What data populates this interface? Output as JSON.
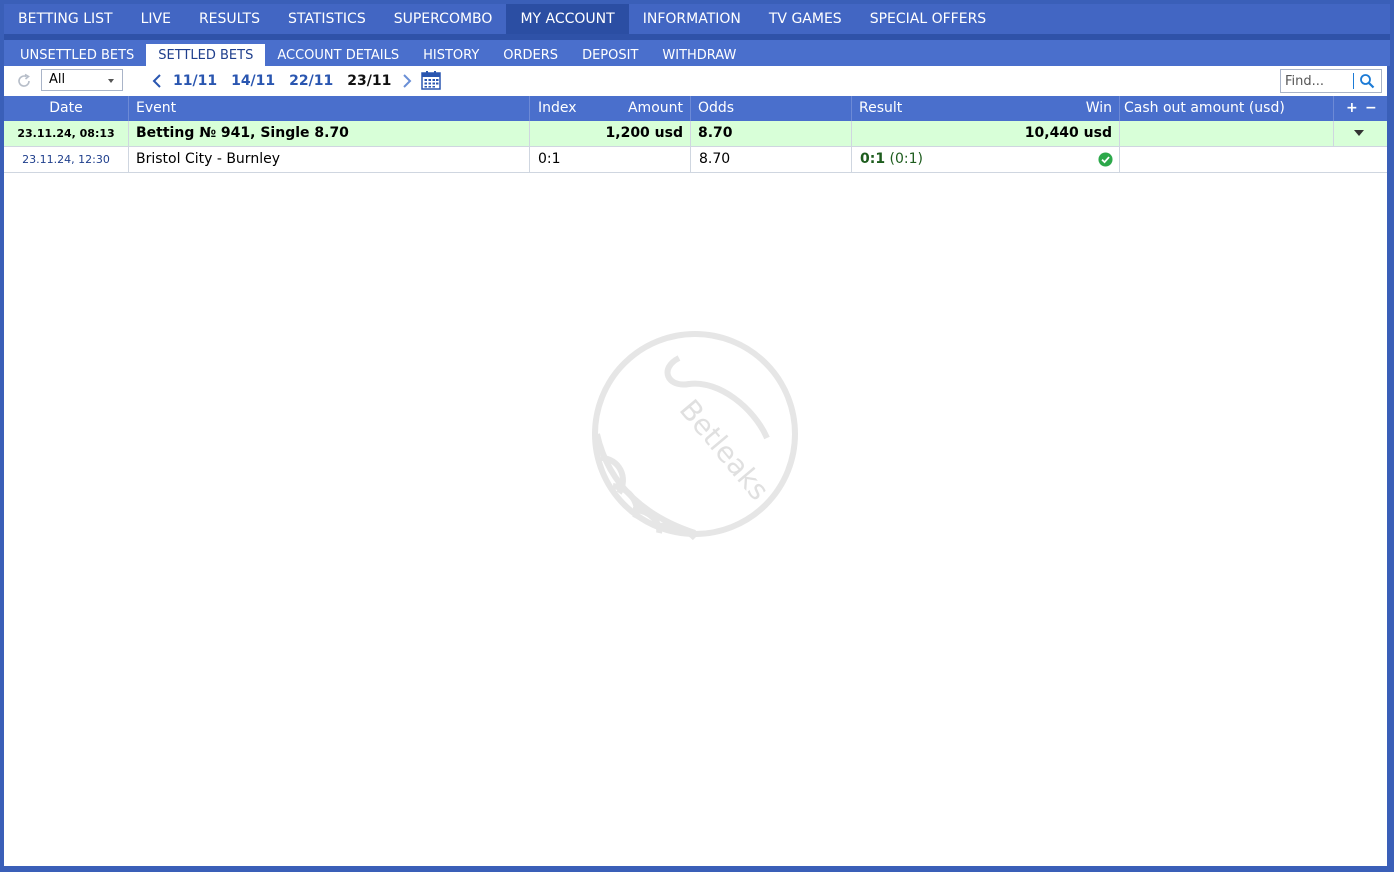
{
  "topnav": [
    {
      "label": "BETTING LIST"
    },
    {
      "label": "LIVE"
    },
    {
      "label": "RESULTS"
    },
    {
      "label": "STATISTICS"
    },
    {
      "label": "SUPERCOMBO"
    },
    {
      "label": "MY ACCOUNT"
    },
    {
      "label": "INFORMATION"
    },
    {
      "label": "TV GAMES"
    },
    {
      "label": "SPECIAL OFFERS"
    }
  ],
  "subnav": [
    {
      "label": "UNSETTLED BETS"
    },
    {
      "label": "SETTLED BETS"
    },
    {
      "label": "ACCOUNT DETAILS"
    },
    {
      "label": "HISTORY"
    },
    {
      "label": "ORDERS"
    },
    {
      "label": "DEPOSIT"
    },
    {
      "label": "WITHDRAW"
    }
  ],
  "toolbar": {
    "filter_value": "All",
    "dates": [
      "11/11",
      "14/11",
      "22/11",
      "23/11"
    ],
    "search_placeholder": "Find..."
  },
  "table": {
    "headers": {
      "date": "Date",
      "event": "Event",
      "index": "Index",
      "amount": "Amount",
      "odds": "Odds",
      "result": "Result",
      "win": "Win",
      "cashout": "Cash out amount (usd)",
      "expand": "+",
      "collapse": "−"
    },
    "bet": {
      "date": "23.11.24,  08:13",
      "title": "Betting № 941, Single 8.70",
      "amount": "1,200 usd",
      "odds": "8.70",
      "win": "10,440 usd"
    },
    "events": [
      {
        "date": "23.11.24, 12:30",
        "event": "Bristol City - Burnley",
        "index": "0:1",
        "odds": "8.70",
        "result_score": "0:1",
        "result_half": "(0:1)",
        "status": "won"
      }
    ]
  },
  "watermark_text": "Betleaks"
}
